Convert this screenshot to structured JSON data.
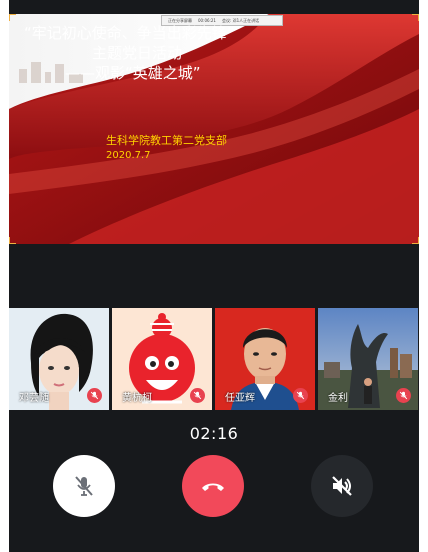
{
  "share_bar": {
    "left": "正在分享屏幕",
    "time": "00:06:21",
    "right": "会议: 邓1人正在讲话"
  },
  "slide": {
    "title_line1": "“牢记初心使命、争当出彩先锋”",
    "title_line2": "主题党日活动",
    "title_line3": "——观影“英雄之城”",
    "org": "生科学院教工第二党支部",
    "date": "2020.7.7"
  },
  "participants": [
    {
      "name": "邓芸随",
      "muted": true
    },
    {
      "name": "黄杭柯",
      "muted": true
    },
    {
      "name": "任亚辉",
      "muted": true
    },
    {
      "name": "金利",
      "muted": true
    }
  ],
  "call": {
    "duration": "02:16"
  },
  "controls": {
    "mic": {
      "icon": "mic-muted-icon",
      "state": "muted"
    },
    "hangup": {
      "icon": "phone-hangup-icon",
      "color": "#f2495a"
    },
    "speaker": {
      "icon": "speaker-muted-icon",
      "state": "muted"
    }
  },
  "colors": {
    "background": "#17191c",
    "accent_red": "#f2495a",
    "slide_red": "#8e0f12",
    "slide_text_yellow": "#ffd200"
  }
}
